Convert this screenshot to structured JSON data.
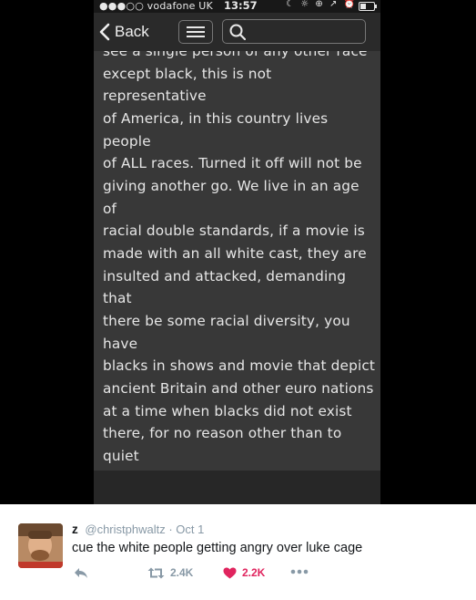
{
  "status_bar": {
    "carrier": "●●●○○ vodafone UK",
    "time": "13:57",
    "right_icons": "☾ ☼ ⊕ ↗ ⏰"
  },
  "nav": {
    "back_label": "Back",
    "search_placeholder": ""
  },
  "post": {
    "text": "see a single person of any other race\nexcept black, this is not representative\nof America, in this country lives people\nof ALL races. Turned it off will not be\ngiving another go. We live in an age of\nracial double standards, if a movie is\nmade with an all white cast, they are\ninsulted and attacked, demanding that\nthere be some racial diversity, you have\nblacks in shows and movie that depict\nancient Britain and other euro nations\nat a time when blacks did not exist\nthere, for no reason other than to quiet\nthe violent black mobs. It is not my\nintention to spread,justify or glorify the\nhate in this country, but turnabout is\nfair play. If it isn't racially diverse i won't\nwatch it."
  },
  "tweet": {
    "name": "z",
    "handle": "@christphwaltz",
    "date": "· Oct 1",
    "text": "cue the white people getting angry over luke cage",
    "retweets": "2.4K",
    "likes": "2.2K",
    "colors": {
      "like": "#e0245e",
      "muted": "#8899a6"
    }
  }
}
